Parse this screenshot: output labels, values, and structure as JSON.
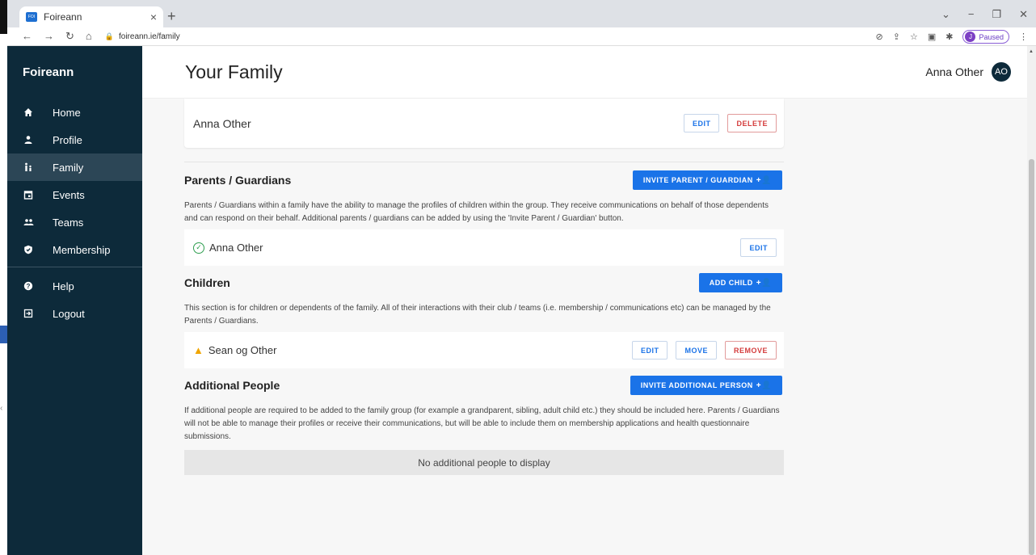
{
  "browser": {
    "tab_title": "Foireann",
    "favicon_text": "FOI",
    "url": "foireann.ie/family",
    "paused_label": "Paused",
    "profile_initial": "J"
  },
  "sidebar": {
    "brand": "Foireann",
    "items": [
      {
        "label": "Home",
        "icon": "home-icon"
      },
      {
        "label": "Profile",
        "icon": "person-icon"
      },
      {
        "label": "Family",
        "icon": "family-icon"
      },
      {
        "label": "Events",
        "icon": "calendar-icon"
      },
      {
        "label": "Teams",
        "icon": "group-icon"
      },
      {
        "label": "Membership",
        "icon": "shield-icon"
      }
    ],
    "bottom_items": [
      {
        "label": "Help",
        "icon": "help-icon"
      },
      {
        "label": "Logout",
        "icon": "logout-icon"
      }
    ]
  },
  "header": {
    "title": "Your Family",
    "user_name": "Anna Other",
    "user_initials": "AO"
  },
  "owner": {
    "name": "Anna Other",
    "edit_label": "EDIT",
    "delete_label": "DELETE"
  },
  "parents": {
    "title": "Parents / Guardians",
    "invite_label": "INVITE PARENT / GUARDIAN",
    "description": "Parents / Guardians within a family have the ability to manage the profiles of children within the group. They receive communications on behalf of those dependents and can respond on their behalf. Additional parents / guardians can be added by using the 'Invite Parent / Guardian' button.",
    "members": [
      {
        "name": "Anna Other",
        "edit_label": "EDIT"
      }
    ]
  },
  "children": {
    "title": "Children",
    "add_label": "ADD CHILD",
    "description": "This section is for children or dependents of the family. All of their interactions with their club / teams (i.e. membership / communications etc) can be managed by the Parents / Guardians.",
    "members": [
      {
        "name": "Sean og Other",
        "edit_label": "EDIT",
        "move_label": "MOVE",
        "remove_label": "REMOVE"
      }
    ]
  },
  "additional": {
    "title": "Additional People",
    "invite_label": "INVITE ADDITIONAL PERSON",
    "description": "If additional people are required to be added to the family group (for example a grandparent, sibling, adult child etc.) they should be included here. Parents / Guardians will not be able to manage their profiles or receive their communications, but will be able to include them on membership applications and health questionnaire submissions.",
    "empty_text": "No additional people to display"
  }
}
